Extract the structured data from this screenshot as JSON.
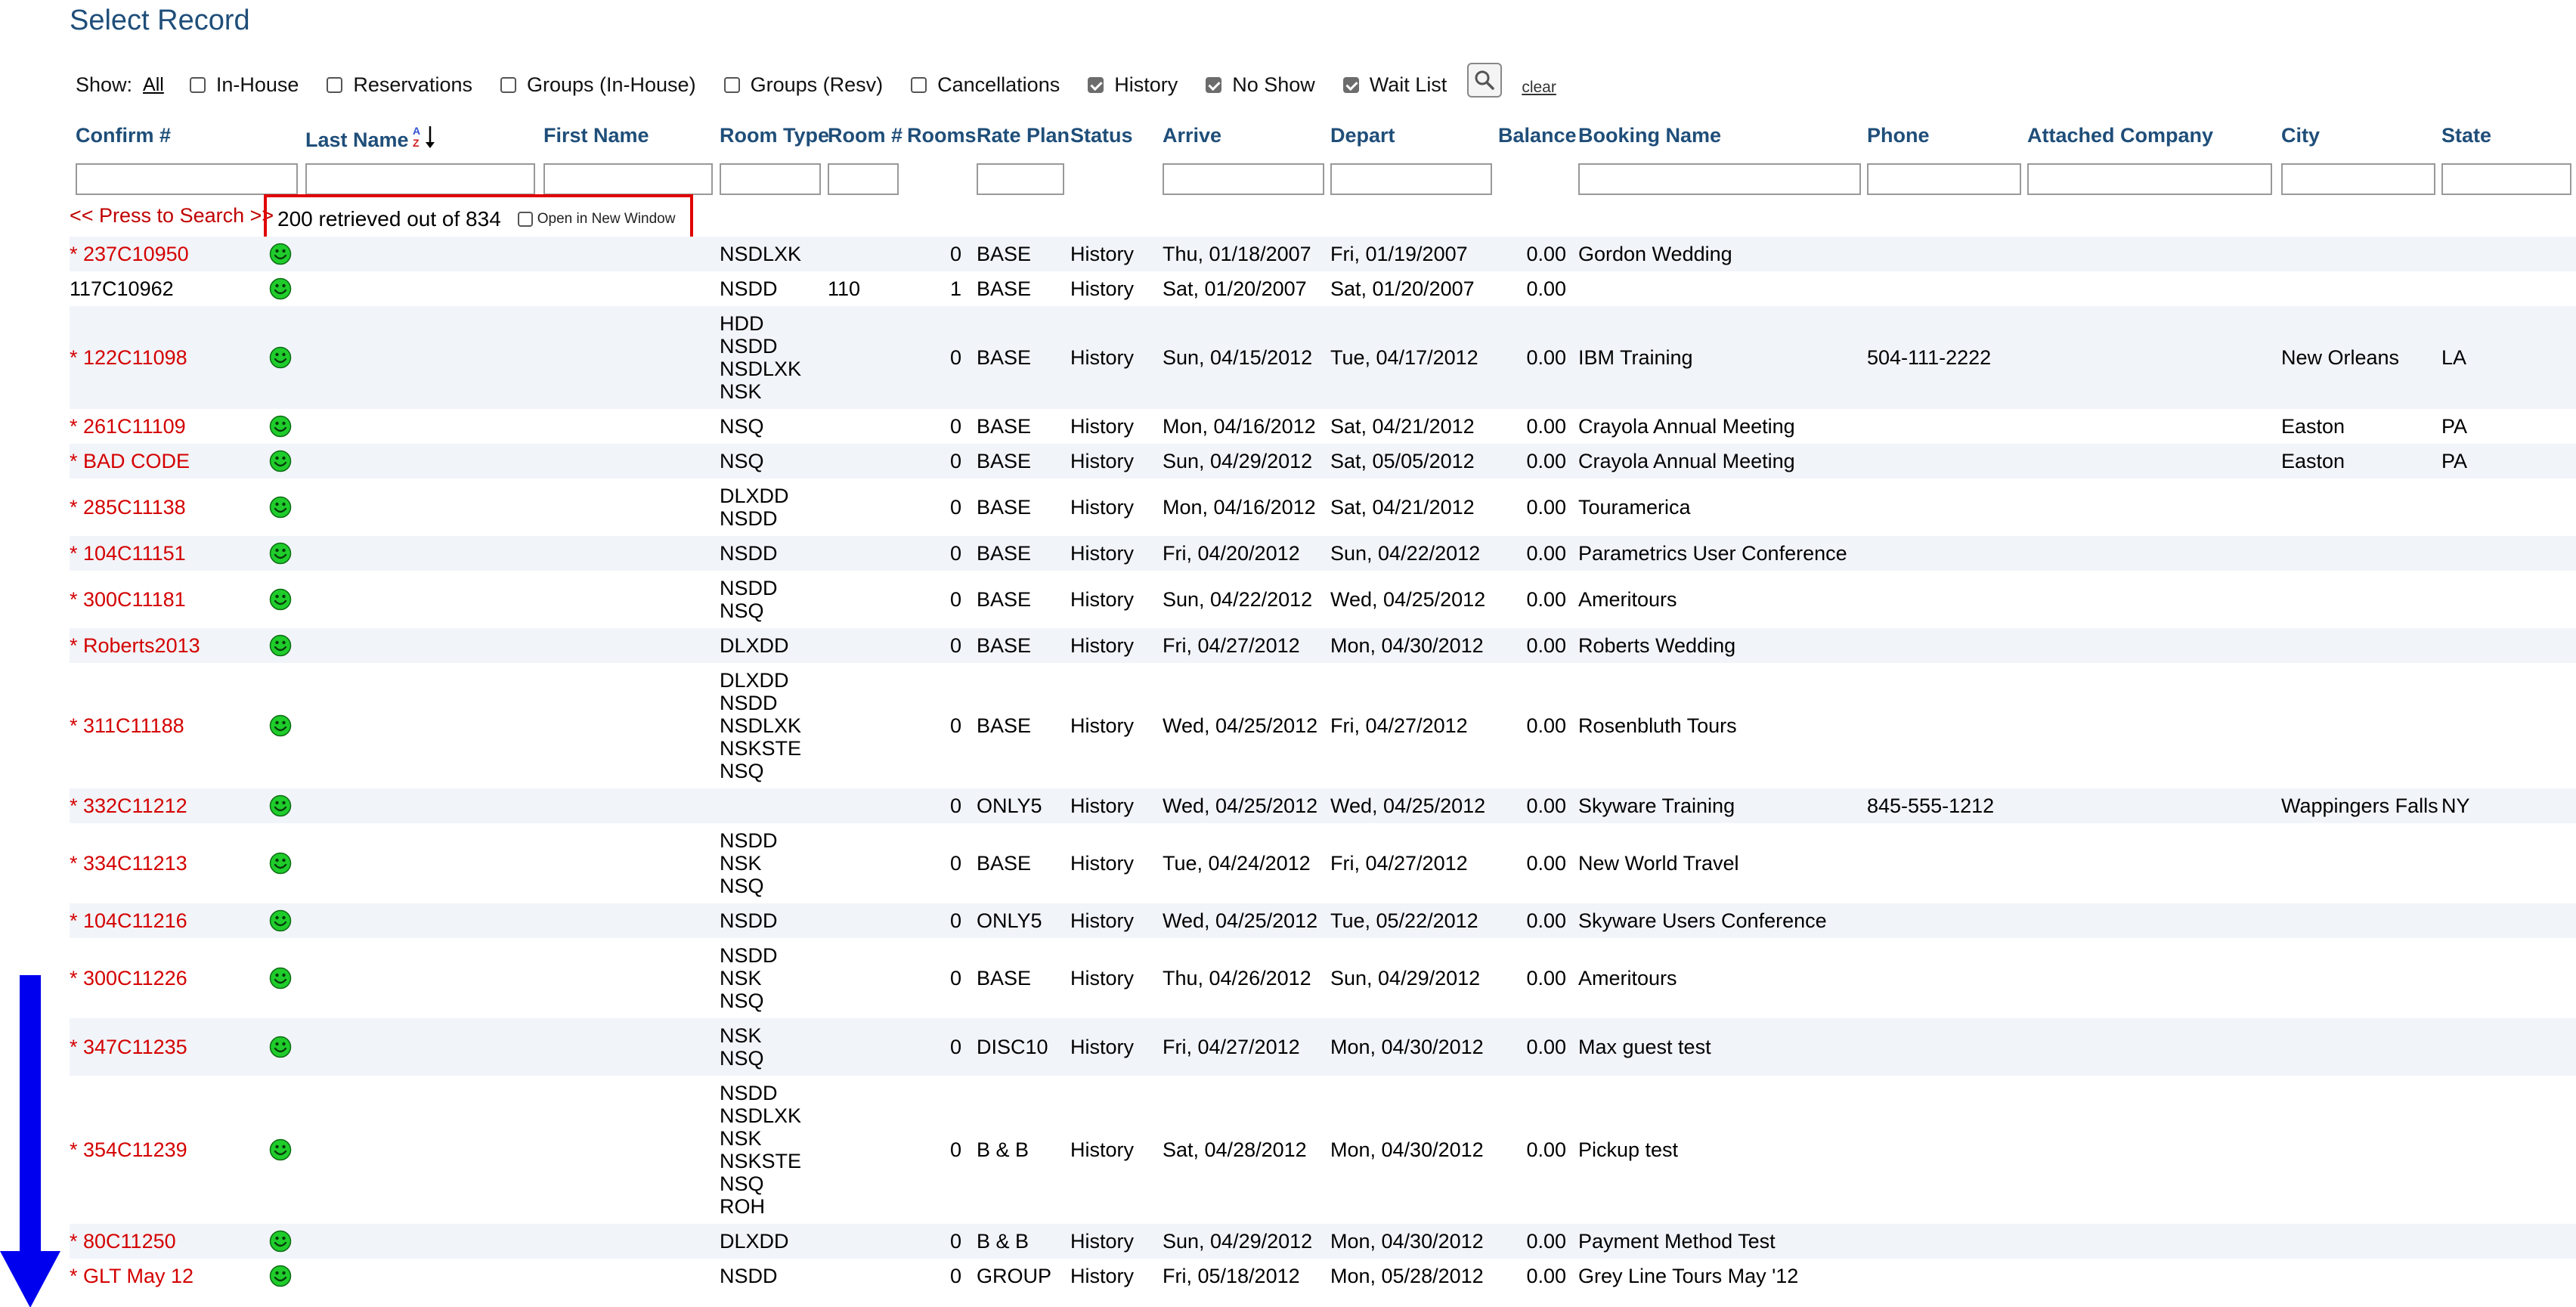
{
  "title": "Select Record",
  "show": {
    "label": "Show:",
    "all": "All",
    "options": [
      {
        "label": "In-House",
        "checked": false
      },
      {
        "label": "Reservations",
        "checked": false
      },
      {
        "label": "Groups (In-House)",
        "checked": false
      },
      {
        "label": "Groups (Resv)",
        "checked": false
      },
      {
        "label": "Cancellations",
        "checked": false
      },
      {
        "label": "History",
        "checked": true
      },
      {
        "label": "No Show",
        "checked": true
      },
      {
        "label": "Wait List",
        "checked": true
      }
    ],
    "clear": "clear"
  },
  "columns": [
    "Confirm #",
    "Last Name",
    "First Name",
    "Room Type",
    "Room #",
    "Rooms",
    "Rate Plan",
    "Status",
    "Arrive",
    "Depart",
    "Balance",
    "Booking Name",
    "Phone",
    "Attached Company",
    "City",
    "State"
  ],
  "press_to_search": "<< Press to Search >>",
  "retrieved": "200 retrieved out of 834",
  "open_new_window": "Open in New Window",
  "rows": [
    {
      "confirm": "* 237C10950",
      "red": true,
      "room_type": [
        "NSDLXK"
      ],
      "room_no": "",
      "rooms": "0",
      "rate_plan": "BASE",
      "status": "History",
      "arrive": "Thu, 01/18/2007",
      "depart": "Fri, 01/19/2007",
      "balance": "0.00",
      "booking": "Gordon Wedding",
      "phone": "",
      "company": "",
      "city": "",
      "state": ""
    },
    {
      "confirm": "117C10962",
      "red": false,
      "room_type": [
        "NSDD"
      ],
      "room_no": "110",
      "rooms": "1",
      "rate_plan": "BASE",
      "status": "History",
      "arrive": "Sat, 01/20/2007",
      "depart": "Sat, 01/20/2007",
      "balance": "0.00",
      "booking": "",
      "phone": "",
      "company": "",
      "city": "",
      "state": ""
    },
    {
      "confirm": "* 122C11098",
      "red": true,
      "room_type": [
        "HDD",
        "NSDD",
        "NSDLXK",
        "NSK"
      ],
      "room_no": "",
      "rooms": "0",
      "rate_plan": "BASE",
      "status": "History",
      "arrive": "Sun, 04/15/2012",
      "depart": "Tue, 04/17/2012",
      "balance": "0.00",
      "booking": "IBM Training",
      "phone": "504-111-2222",
      "company": "",
      "city": "New Orleans",
      "state": "LA"
    },
    {
      "confirm": "* 261C11109",
      "red": true,
      "room_type": [
        "NSQ"
      ],
      "room_no": "",
      "rooms": "0",
      "rate_plan": "BASE",
      "status": "History",
      "arrive": "Mon, 04/16/2012",
      "depart": "Sat, 04/21/2012",
      "balance": "0.00",
      "booking": "Crayola Annual Meeting",
      "phone": "",
      "company": "",
      "city": "Easton",
      "state": "PA"
    },
    {
      "confirm": "* BAD CODE",
      "red": true,
      "room_type": [
        "NSQ"
      ],
      "room_no": "",
      "rooms": "0",
      "rate_plan": "BASE",
      "status": "History",
      "arrive": "Sun, 04/29/2012",
      "depart": "Sat, 05/05/2012",
      "balance": "0.00",
      "booking": "Crayola Annual Meeting",
      "phone": "",
      "company": "",
      "city": "Easton",
      "state": "PA"
    },
    {
      "confirm": "* 285C11138",
      "red": true,
      "room_type": [
        "DLXDD",
        "NSDD"
      ],
      "room_no": "",
      "rooms": "0",
      "rate_plan": "BASE",
      "status": "History",
      "arrive": "Mon, 04/16/2012",
      "depart": "Sat, 04/21/2012",
      "balance": "0.00",
      "booking": "Touramerica",
      "phone": "",
      "company": "",
      "city": "",
      "state": ""
    },
    {
      "confirm": "* 104C11151",
      "red": true,
      "room_type": [
        "NSDD"
      ],
      "room_no": "",
      "rooms": "0",
      "rate_plan": "BASE",
      "status": "History",
      "arrive": "Fri, 04/20/2012",
      "depart": "Sun, 04/22/2012",
      "balance": "0.00",
      "booking": "Parametrics User Conference",
      "phone": "",
      "company": "",
      "city": "",
      "state": ""
    },
    {
      "confirm": "* 300C11181",
      "red": true,
      "room_type": [
        "NSDD",
        "NSQ"
      ],
      "room_no": "",
      "rooms": "0",
      "rate_plan": "BASE",
      "status": "History",
      "arrive": "Sun, 04/22/2012",
      "depart": "Wed, 04/25/2012",
      "balance": "0.00",
      "booking": "Ameritours",
      "phone": "",
      "company": "",
      "city": "",
      "state": ""
    },
    {
      "confirm": "* Roberts2013",
      "red": true,
      "room_type": [
        "DLXDD"
      ],
      "room_no": "",
      "rooms": "0",
      "rate_plan": "BASE",
      "status": "History",
      "arrive": "Fri, 04/27/2012",
      "depart": "Mon, 04/30/2012",
      "balance": "0.00",
      "booking": "Roberts Wedding",
      "phone": "",
      "company": "",
      "city": "",
      "state": ""
    },
    {
      "confirm": "* 311C11188",
      "red": true,
      "room_type": [
        "DLXDD",
        "NSDD",
        "NSDLXK",
        "NSKSTE",
        "NSQ"
      ],
      "room_no": "",
      "rooms": "0",
      "rate_plan": "BASE",
      "status": "History",
      "arrive": "Wed, 04/25/2012",
      "depart": "Fri, 04/27/2012",
      "balance": "0.00",
      "booking": "Rosenbluth Tours",
      "phone": "",
      "company": "",
      "city": "",
      "state": ""
    },
    {
      "confirm": "* 332C11212",
      "red": true,
      "room_type": [],
      "room_no": "",
      "rooms": "0",
      "rate_plan": "ONLY5",
      "status": "History",
      "arrive": "Wed, 04/25/2012",
      "depart": "Wed, 04/25/2012",
      "balance": "0.00",
      "booking": "Skyware Training",
      "phone": "845-555-1212",
      "company": "",
      "city": "Wappingers Falls",
      "state": "NY"
    },
    {
      "confirm": "* 334C11213",
      "red": true,
      "room_type": [
        "NSDD",
        "NSK",
        "NSQ"
      ],
      "room_no": "",
      "rooms": "0",
      "rate_plan": "BASE",
      "status": "History",
      "arrive": "Tue, 04/24/2012",
      "depart": "Fri, 04/27/2012",
      "balance": "0.00",
      "booking": "New World Travel",
      "phone": "",
      "company": "",
      "city": "",
      "state": ""
    },
    {
      "confirm": "* 104C11216",
      "red": true,
      "room_type": [
        "NSDD"
      ],
      "room_no": "",
      "rooms": "0",
      "rate_plan": "ONLY5",
      "status": "History",
      "arrive": "Wed, 04/25/2012",
      "depart": "Tue, 05/22/2012",
      "balance": "0.00",
      "booking": "Skyware Users Conference",
      "phone": "",
      "company": "",
      "city": "",
      "state": ""
    },
    {
      "confirm": "* 300C11226",
      "red": true,
      "room_type": [
        "NSDD",
        "NSK",
        "NSQ"
      ],
      "room_no": "",
      "rooms": "0",
      "rate_plan": "BASE",
      "status": "History",
      "arrive": "Thu, 04/26/2012",
      "depart": "Sun, 04/29/2012",
      "balance": "0.00",
      "booking": "Ameritours",
      "phone": "",
      "company": "",
      "city": "",
      "state": ""
    },
    {
      "confirm": "* 347C11235",
      "red": true,
      "room_type": [
        "NSK",
        "NSQ"
      ],
      "room_no": "",
      "rooms": "0",
      "rate_plan": "DISC10",
      "status": "History",
      "arrive": "Fri, 04/27/2012",
      "depart": "Mon, 04/30/2012",
      "balance": "0.00",
      "booking": "Max guest test",
      "phone": "",
      "company": "",
      "city": "",
      "state": ""
    },
    {
      "confirm": "* 354C11239",
      "red": true,
      "room_type": [
        "NSDD",
        "NSDLXK",
        "NSK",
        "NSKSTE",
        "NSQ",
        "ROH"
      ],
      "room_no": "",
      "rooms": "0",
      "rate_plan": "B & B",
      "status": "History",
      "arrive": "Sat, 04/28/2012",
      "depart": "Mon, 04/30/2012",
      "balance": "0.00",
      "booking": "Pickup test",
      "phone": "",
      "company": "",
      "city": "",
      "state": ""
    },
    {
      "confirm": "* 80C11250",
      "red": true,
      "room_type": [
        "DLXDD"
      ],
      "room_no": "",
      "rooms": "0",
      "rate_plan": "B & B",
      "status": "History",
      "arrive": "Sun, 04/29/2012",
      "depart": "Mon, 04/30/2012",
      "balance": "0.00",
      "booking": "Payment Method Test",
      "phone": "",
      "company": "",
      "city": "",
      "state": ""
    },
    {
      "confirm": "* GLT May 12",
      "red": true,
      "room_type": [
        "NSDD"
      ],
      "room_no": "",
      "rooms": "0",
      "rate_plan": "GROUP",
      "status": "History",
      "arrive": "Fri, 05/18/2012",
      "depart": "Mon, 05/28/2012",
      "balance": "0.00",
      "booking": "Grey Line Tours May '12",
      "phone": "",
      "company": "",
      "city": "",
      "state": ""
    }
  ],
  "icons": {
    "smiley": "smiley-icon",
    "search": "magnifier-icon",
    "sort": "sort-az-icon",
    "scroll": "down-arrow-icon"
  },
  "colors": {
    "title": "#1f4e79",
    "confirm_red": "#d40000",
    "highlight_box": "#e00000",
    "smiley": "#1fcc2b",
    "arrow": "#0000ee"
  }
}
